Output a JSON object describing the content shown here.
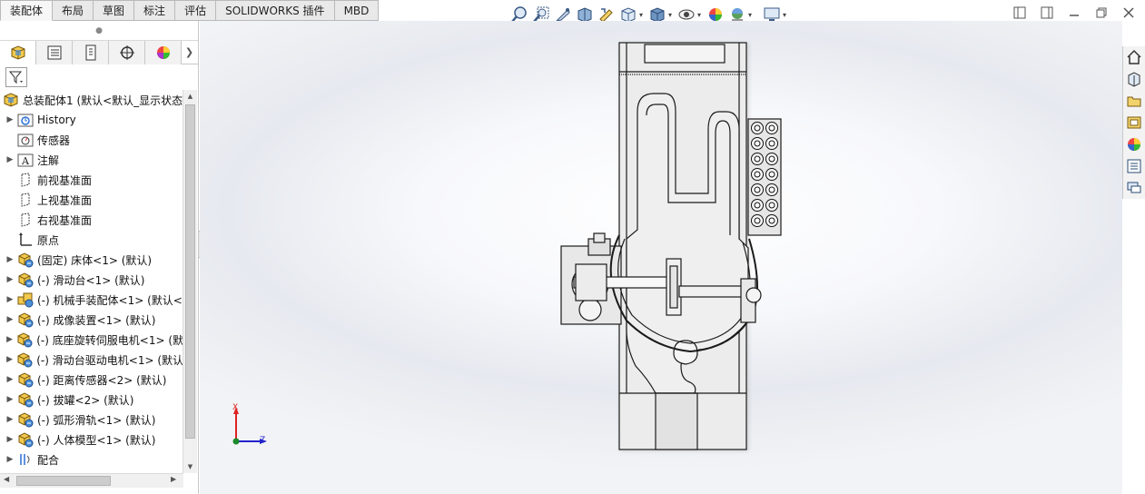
{
  "tabs": [
    {
      "label": "装配体",
      "active": true
    },
    {
      "label": "布局",
      "active": false
    },
    {
      "label": "草图",
      "active": false
    },
    {
      "label": "标注",
      "active": false
    },
    {
      "label": "评估",
      "active": false
    },
    {
      "label": "SOLIDWORKS 插件",
      "active": false
    },
    {
      "label": "MBD",
      "active": false
    }
  ],
  "hud_icons": [
    "zoom-to-fit-icon",
    "zoom-to-area-icon",
    "previous-view-icon",
    "section-view-icon",
    "dynamic-annotation-icon",
    "view-orientation-icon",
    "display-style-icon",
    "hide-show-items-icon",
    "edit-appearance-icon",
    "apply-scene-icon",
    "view-settings-icon"
  ],
  "panel_tabs": [
    "featuremanager-icon",
    "propertymanager-icon",
    "configurationmanager-icon",
    "dimxpert-icon",
    "display-manager-icon"
  ],
  "tree": {
    "root_label": "总装配体1  (默认<默认_显示状态",
    "items": [
      {
        "label": "History",
        "icon": "history-folder-icon",
        "expandable": true
      },
      {
        "label": "传感器",
        "icon": "sensors-icon",
        "expandable": false
      },
      {
        "label": "注解",
        "icon": "annotations-icon",
        "expandable": true
      },
      {
        "label": "前视基准面",
        "icon": "plane-icon",
        "expandable": false
      },
      {
        "label": "上视基准面",
        "icon": "plane-icon",
        "expandable": false
      },
      {
        "label": "右视基准面",
        "icon": "plane-icon",
        "expandable": false
      },
      {
        "label": "原点",
        "icon": "origin-icon",
        "expandable": false
      },
      {
        "label": "(固定) 床体<1> (默认)",
        "icon": "part-icon",
        "expandable": true
      },
      {
        "label": "(-) 滑动台<1> (默认)",
        "icon": "part-icon",
        "expandable": true
      },
      {
        "label": "(-) 机械手装配体<1> (默认<",
        "icon": "subassembly-icon",
        "expandable": true
      },
      {
        "label": "(-) 成像装置<1> (默认)",
        "icon": "part-icon",
        "expandable": true
      },
      {
        "label": "(-) 底座旋转伺服电机<1> (默",
        "icon": "part-icon",
        "expandable": true
      },
      {
        "label": "(-) 滑动台驱动电机<1> (默认",
        "icon": "part-icon",
        "expandable": true
      },
      {
        "label": "(-) 距离传感器<2> (默认)",
        "icon": "part-icon",
        "expandable": true
      },
      {
        "label": "(-) 拔罐<2> (默认)",
        "icon": "part-icon",
        "expandable": true
      },
      {
        "label": "(-) 弧形滑轨<1> (默认)",
        "icon": "part-icon",
        "expandable": true
      },
      {
        "label": "(-) 人体模型<1> (默认)",
        "icon": "part-icon",
        "expandable": true
      },
      {
        "label": "配合",
        "icon": "mates-icon",
        "expandable": true
      }
    ]
  },
  "triad": {
    "x_label": "X",
    "z_label": "Z"
  },
  "task_pane": [
    "home-icon",
    "design-library-icon",
    "file-explorer-icon",
    "view-palette-icon",
    "appearances-icon",
    "custom-properties-icon",
    "forum-icon"
  ],
  "colors": {
    "accent": "#1e6fd9",
    "model_fill": "#ececec",
    "model_edge": "#1a1a1a"
  }
}
